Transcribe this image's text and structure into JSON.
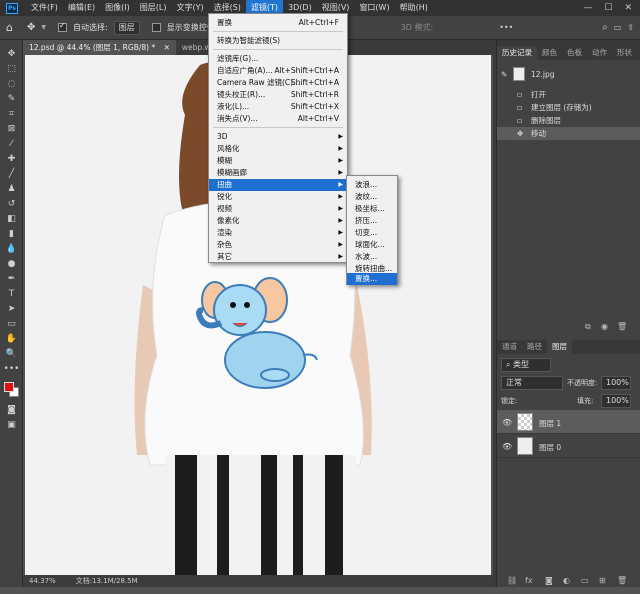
{
  "app": {
    "logo": "Ps"
  },
  "menubar": {
    "items": [
      "文件(F)",
      "编辑(E)",
      "图像(I)",
      "图层(L)",
      "文字(Y)",
      "选择(S)",
      "滤镜(T)",
      "3D(D)",
      "视图(V)",
      "窗口(W)",
      "帮助(H)"
    ],
    "active_index": 6
  },
  "options": {
    "auto_select_label": "自动选择:",
    "auto_select_value": "图层",
    "transform_label": "显示变换控件",
    "mode_3d": "3D 模式:"
  },
  "document": {
    "tabs": [
      "12.psd @ 44.4% (图层 1, RGB/8) *",
      "webp.webp.jpg @ 5..."
    ],
    "zoom": "44.37%",
    "doc_size": "文档:13.1M/28.5M"
  },
  "filter_menu": {
    "items": [
      {
        "label": "置换",
        "shortcut": "Alt+Ctrl+F"
      },
      {
        "label": "转换为智能滤镜(S)",
        "shortcut": ""
      },
      {
        "label": "滤镜库(G)...",
        "shortcut": ""
      },
      {
        "label": "自适应广角(A)...",
        "shortcut": "Alt+Shift+Ctrl+A"
      },
      {
        "label": "Camera Raw 滤镜(C)...",
        "shortcut": "Shift+Ctrl+A"
      },
      {
        "label": "镜头校正(R)...",
        "shortcut": "Shift+Ctrl+R"
      },
      {
        "label": "液化(L)...",
        "shortcut": "Shift+Ctrl+X"
      },
      {
        "label": "消失点(V)...",
        "shortcut": "Alt+Ctrl+V"
      },
      {
        "label": "3D",
        "shortcut": ""
      },
      {
        "label": "风格化",
        "shortcut": ""
      },
      {
        "label": "模糊",
        "shortcut": ""
      },
      {
        "label": "模糊画廊",
        "shortcut": ""
      },
      {
        "label": "扭曲",
        "shortcut": ""
      },
      {
        "label": "锐化",
        "shortcut": ""
      },
      {
        "label": "视频",
        "shortcut": ""
      },
      {
        "label": "像素化",
        "shortcut": ""
      },
      {
        "label": "渲染",
        "shortcut": ""
      },
      {
        "label": "杂色",
        "shortcut": ""
      },
      {
        "label": "其它",
        "shortcut": ""
      }
    ]
  },
  "distort_submenu": {
    "items": [
      "波浪...",
      "波纹...",
      "极坐标...",
      "挤压...",
      "切变...",
      "球面化...",
      "水波...",
      "旋转扭曲...",
      "置换..."
    ]
  },
  "history_panel": {
    "tabs": [
      "历史记录",
      "颜色",
      "色板",
      "动作",
      "形状"
    ],
    "snapshot": "12.jpg",
    "steps": [
      "打开",
      "建立图层 (存储为)",
      "删除图层",
      "移动"
    ]
  },
  "layers_panel": {
    "tabs": [
      "通道",
      "路径",
      "图层"
    ],
    "filter_label": "类型",
    "blend_mode": "正常",
    "opacity_label": "不透明度:",
    "opacity": "100%",
    "lock_label": "锁定:",
    "fill_label": "填充:",
    "fill": "100%",
    "layers": [
      "图层 1",
      "图层 0"
    ]
  },
  "colors": {
    "foreground": "#e01010",
    "background": "#ffffff",
    "accent": "#1f6fd0"
  }
}
